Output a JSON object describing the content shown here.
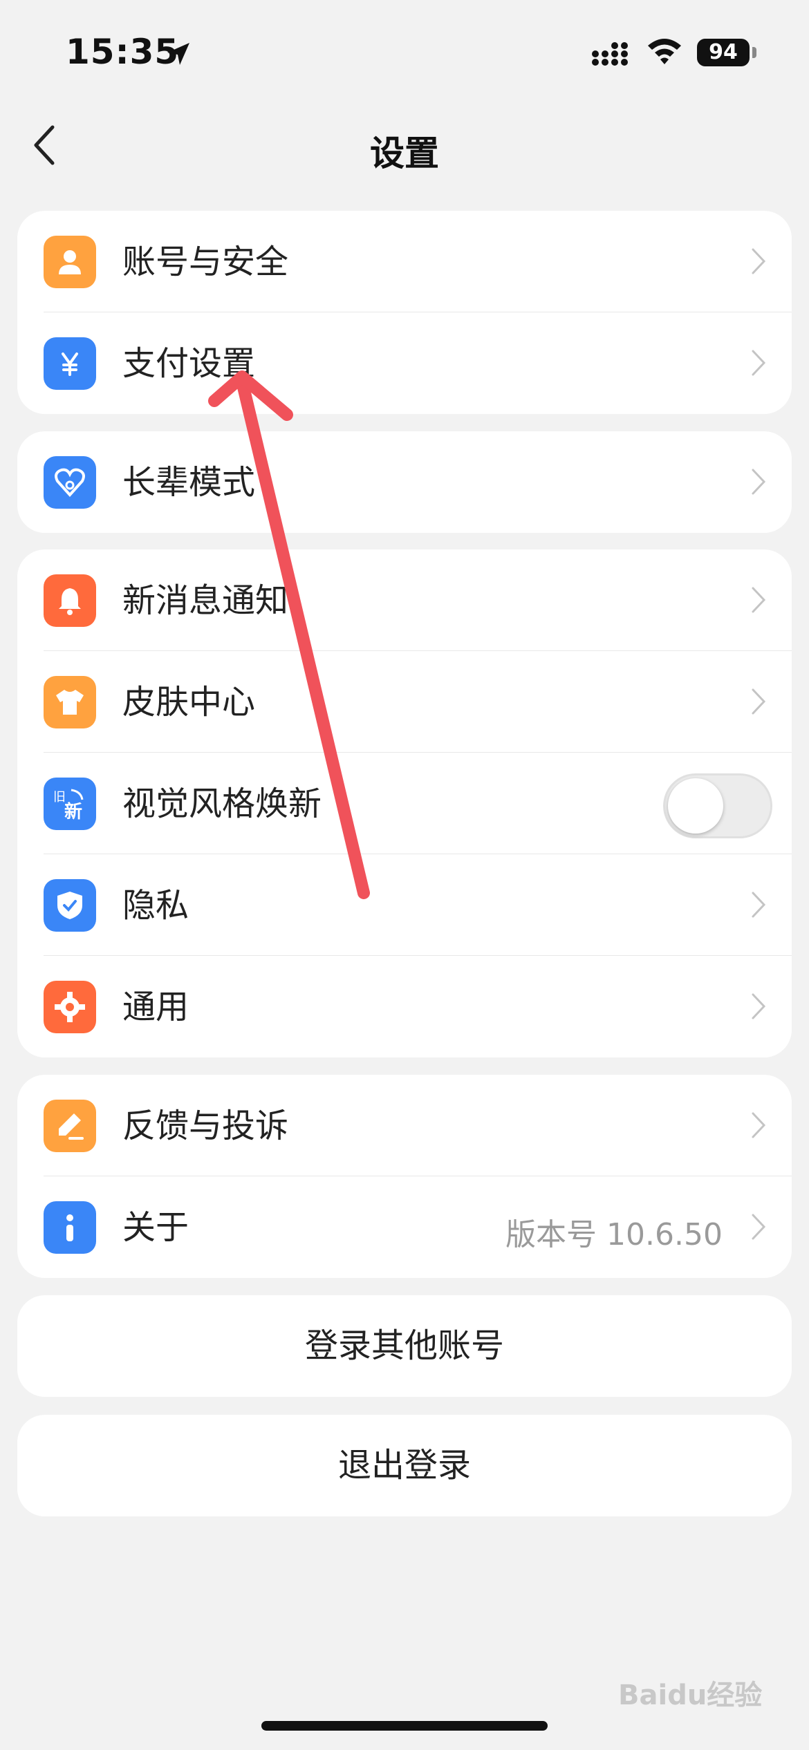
{
  "status_bar": {
    "time": "15:35",
    "battery": "94"
  },
  "nav": {
    "title": "设置"
  },
  "groups": {
    "account": [
      {
        "label": "账号与安全",
        "icon": "person-icon",
        "color": "#ffa23f"
      },
      {
        "label": "支付设置",
        "icon": "yuan-icon",
        "color": "#3a86f7"
      }
    ],
    "elder": [
      {
        "label": "长辈模式",
        "icon": "heart-icon",
        "color": "#3a86f7"
      }
    ],
    "prefs": [
      {
        "label": "新消息通知",
        "icon": "bell-icon",
        "color": "#ff6a3c"
      },
      {
        "label": "皮肤中心",
        "icon": "shirt-icon",
        "color": "#ffa23f"
      },
      {
        "label": "视觉风格焕新",
        "icon": "new-style-icon",
        "color": "#3a86f7",
        "toggle": false,
        "badge_old": "旧",
        "badge_new": "新"
      },
      {
        "label": "隐私",
        "icon": "shield-icon",
        "color": "#3a86f7"
      },
      {
        "label": "通用",
        "icon": "gear-icon",
        "color": "#ff6a3c"
      }
    ],
    "about": [
      {
        "label": "反馈与投诉",
        "icon": "edit-icon",
        "color": "#ffa23f"
      },
      {
        "label": "关于",
        "icon": "info-icon",
        "color": "#3a86f7",
        "value": "版本号 10.6.50"
      }
    ]
  },
  "buttons": {
    "switch_account": "登录其他账号",
    "logout": "退出登录"
  },
  "watermark": "Baidu经验",
  "colors": {
    "background": "#f2f2f2",
    "annotation_arrow": "#f0525a"
  }
}
